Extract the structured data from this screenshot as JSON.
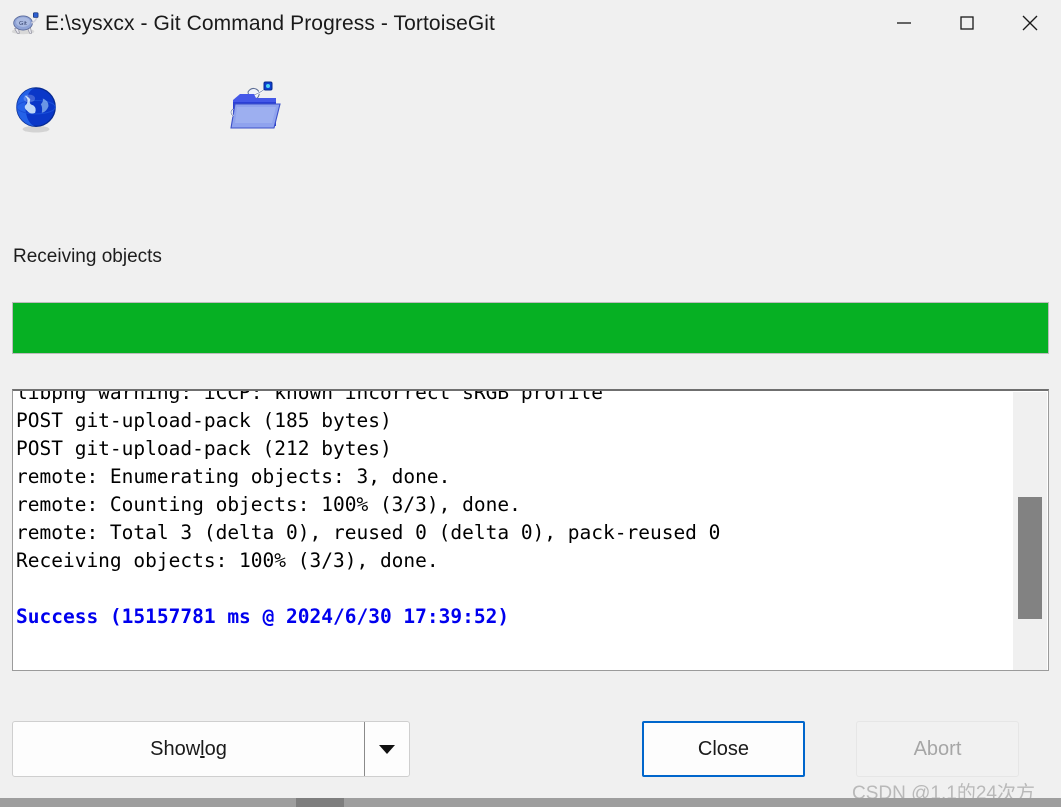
{
  "window": {
    "title": "E:\\sysxcx - Git Command Progress - TortoiseGit",
    "app_icon": "tortoisegit-icon",
    "controls": {
      "minimize": "minimize-icon",
      "maximize": "maximize-icon",
      "close": "close-icon"
    }
  },
  "icons": {
    "globe": "globe-icon",
    "folder": "folder-with-user-icon"
  },
  "status": {
    "label": "Receiving objects"
  },
  "progress": {
    "percent": 100,
    "fill_color": "#06b023",
    "track_color": "#e6e6e6"
  },
  "log": {
    "lines": [
      {
        "text": "libpng warning: iCCP: known incorrect sRGB profile",
        "style": "normal"
      },
      {
        "text": "POST git-upload-pack (185 bytes)",
        "style": "normal"
      },
      {
        "text": "POST git-upload-pack (212 bytes)",
        "style": "normal"
      },
      {
        "text": "remote: Enumerating objects: 3, done.",
        "style": "normal"
      },
      {
        "text": "remote: Counting objects: 100% (3/3), done.",
        "style": "normal"
      },
      {
        "text": "remote: Total 3 (delta 0), reused 0 (delta 0), pack-reused 0",
        "style": "normal"
      },
      {
        "text": "Receiving objects: 100% (3/3), done.",
        "style": "normal"
      },
      {
        "text": "",
        "style": "normal"
      },
      {
        "text": "Success (15157781 ms @ 2024/6/30 17:39:52)",
        "style": "success"
      }
    ],
    "success_color": "#0000ee",
    "scrollbar": {
      "thumb_color": "#828282",
      "track_color": "#f0f0f0"
    }
  },
  "buttons": {
    "show_log": {
      "label_before": "Show ",
      "label_mnemonic": "l",
      "label_after": "og",
      "dropdown_icon": "chevron-down-icon"
    },
    "close": {
      "label": "Close",
      "default": true,
      "accent": "#0066cc"
    },
    "abort": {
      "label": "Abort",
      "disabled": true
    }
  },
  "watermark": {
    "text": "CSDN @1.1的24次方"
  }
}
